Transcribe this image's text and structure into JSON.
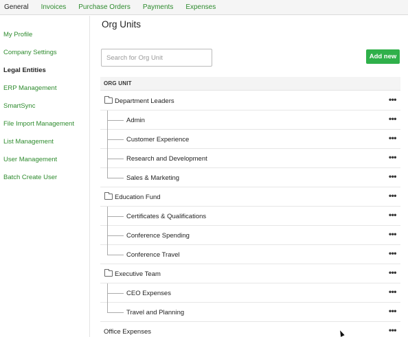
{
  "topnav": {
    "tabs": [
      {
        "label": "General"
      },
      {
        "label": "Invoices"
      },
      {
        "label": "Purchase Orders"
      },
      {
        "label": "Payments"
      },
      {
        "label": "Expenses"
      }
    ]
  },
  "sidebar": {
    "items": [
      {
        "label": "My Profile"
      },
      {
        "label": "Company Settings"
      },
      {
        "label": "Legal Entities"
      },
      {
        "label": "ERP Management"
      },
      {
        "label": "SmartSync"
      },
      {
        "label": "File Import Management"
      },
      {
        "label": "List Management"
      },
      {
        "label": "User Management"
      },
      {
        "label": "Batch Create User"
      }
    ]
  },
  "main": {
    "title": "Org Units",
    "search_placeholder": "Search for Org Unit",
    "add_button": "Add new",
    "column_header": "ORG UNIT",
    "more_glyph": "•••",
    "rows": [
      {
        "label": "Department Leaders"
      },
      {
        "label": "Admin"
      },
      {
        "label": "Customer Experience"
      },
      {
        "label": "Research and Development"
      },
      {
        "label": "Sales & Marketing"
      },
      {
        "label": "Education Fund"
      },
      {
        "label": "Certificates & Qualifications"
      },
      {
        "label": "Conference Spending"
      },
      {
        "label": "Conference Travel"
      },
      {
        "label": "Executive Team"
      },
      {
        "label": "CEO Expenses"
      },
      {
        "label": "Travel and Planning"
      },
      {
        "label": "Office Expenses"
      }
    ]
  },
  "colors": {
    "accent_green": "#2e8b2e",
    "button_green": "#2fb04a"
  }
}
